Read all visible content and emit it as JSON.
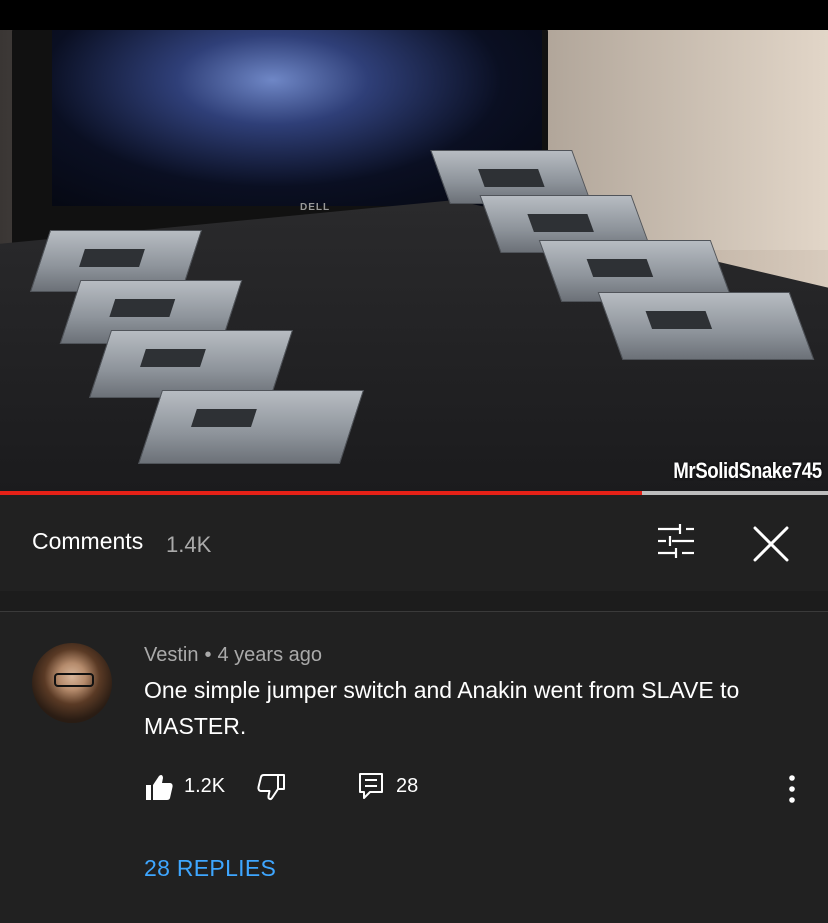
{
  "video": {
    "watermark": "MrSolidSnake745",
    "monitor_brand": "DELL",
    "progress_fraction": 0.775,
    "colors": {
      "progress": "#e62117",
      "buffer": "#bdbdbd"
    }
  },
  "comments_header": {
    "title": "Comments",
    "count": "1.4K",
    "filter_icon": "sliders-icon",
    "close_icon": "close-icon"
  },
  "comment": {
    "author": "Vestin",
    "separator": "•",
    "time": "4 years ago",
    "text": "One simple jumper switch and Anakin went from SLAVE to MASTER.",
    "likes": "1.2K",
    "reply_count": "28",
    "replies_link": "28 REPLIES",
    "icons": {
      "like": "thumbs-up-icon",
      "dislike": "thumbs-down-icon",
      "reply": "comment-icon",
      "more": "more-vertical-icon"
    },
    "colors": {
      "link": "#3ea6ff"
    }
  }
}
